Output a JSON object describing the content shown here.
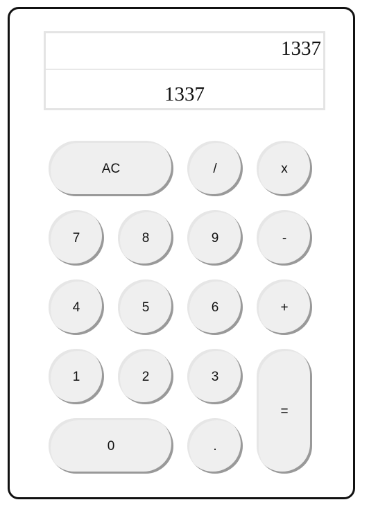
{
  "display": {
    "expression": "1337",
    "result": "1337"
  },
  "keys": {
    "clear": "AC",
    "divide": "/",
    "multiply": "x",
    "seven": "7",
    "eight": "8",
    "nine": "9",
    "subtract": "-",
    "four": "4",
    "five": "5",
    "six": "6",
    "add": "+",
    "one": "1",
    "two": "2",
    "three": "3",
    "equals": "=",
    "zero": "0",
    "decimal": "."
  },
  "colors": {
    "frame_border": "#111111",
    "key_face": "#efefef",
    "key_shadow": "#999999",
    "display_border": "#e4e4e4"
  }
}
